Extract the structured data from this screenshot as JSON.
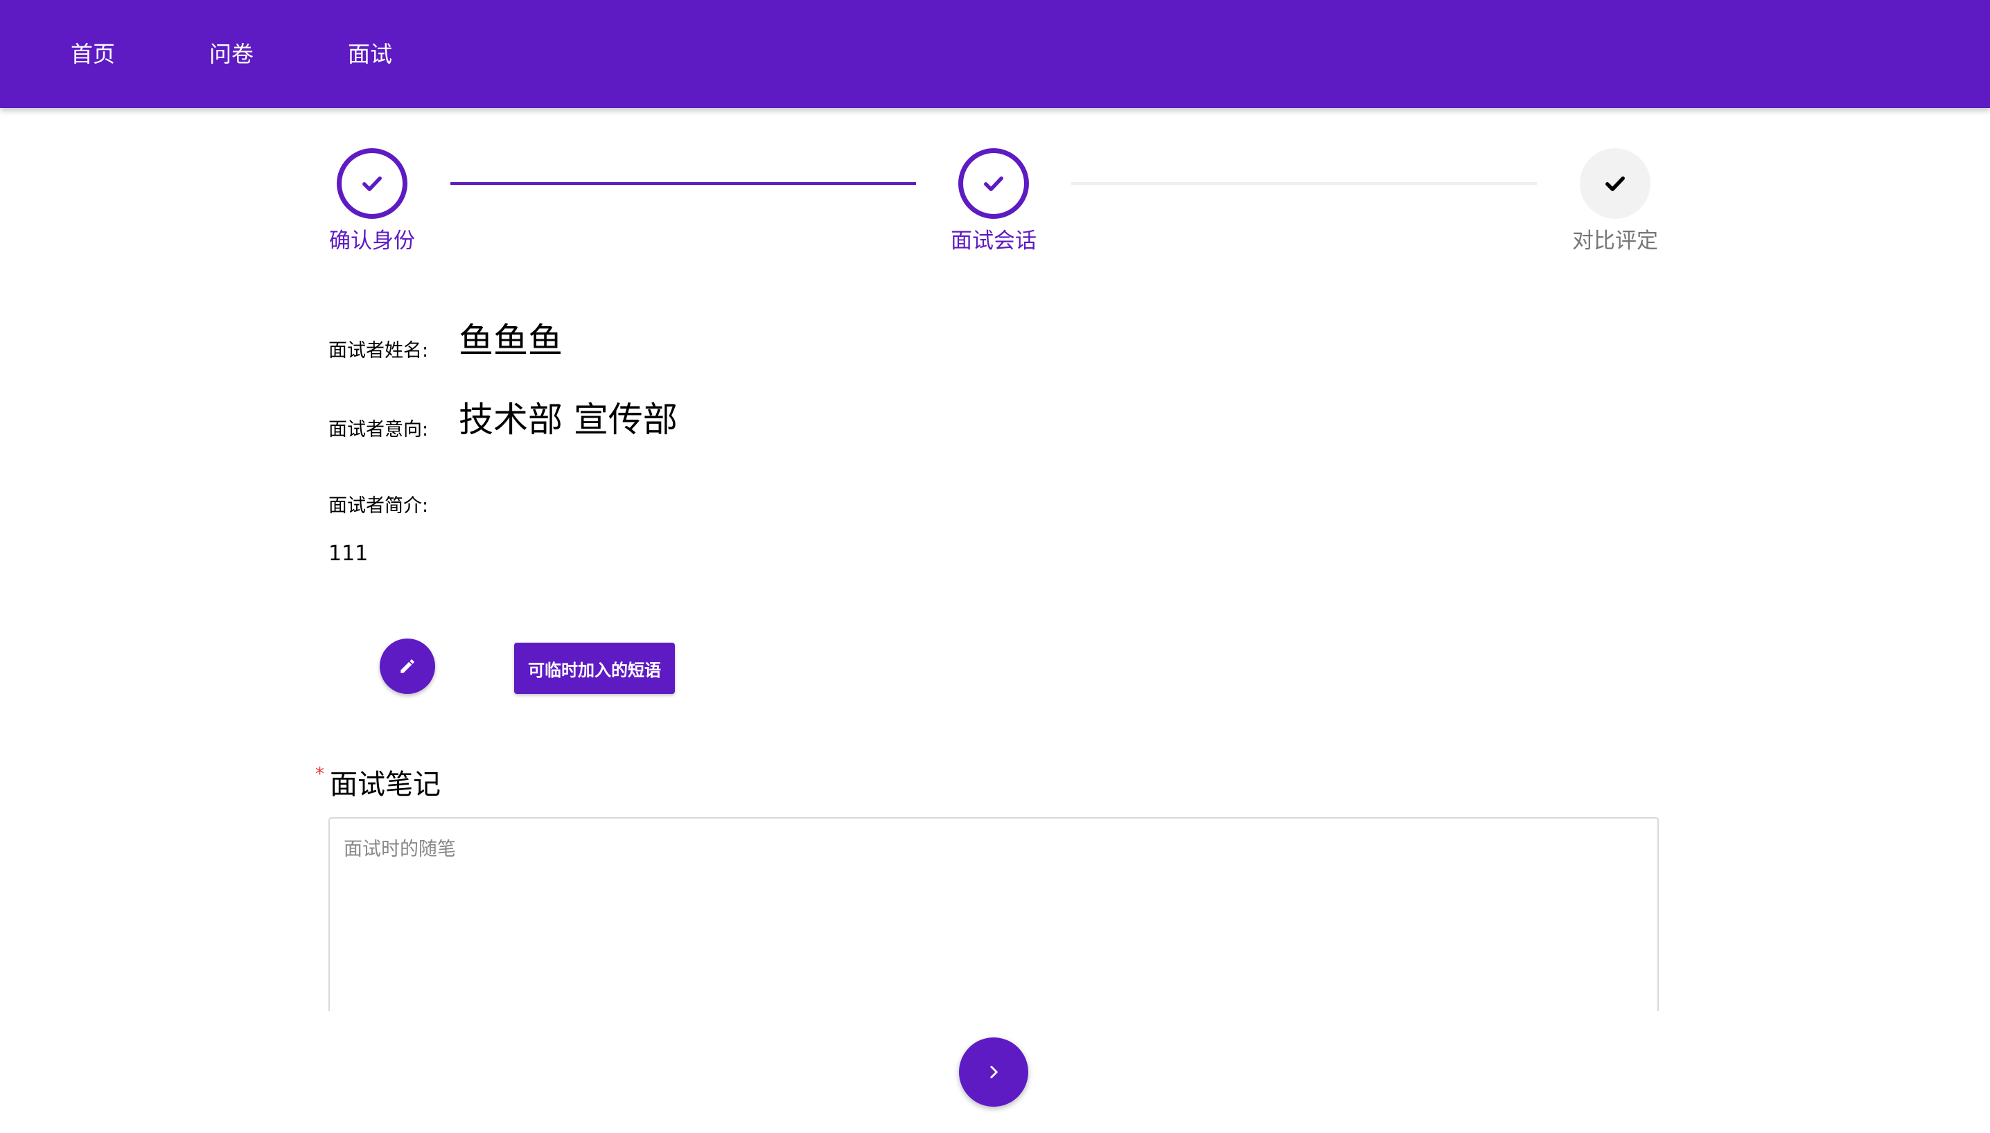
{
  "nav": {
    "items": [
      {
        "label": "首页"
      },
      {
        "label": "问卷"
      },
      {
        "label": "面试"
      }
    ]
  },
  "stepper": {
    "steps": [
      {
        "label": "确认身份",
        "state": "done",
        "icon": "check-icon"
      },
      {
        "label": "面试会话",
        "state": "done",
        "icon": "check-icon"
      },
      {
        "label": "对比评定",
        "state": "todo",
        "icon": "check-icon"
      }
    ]
  },
  "candidate": {
    "name_label": "面试者姓名:",
    "name_value": "鱼鱼鱼",
    "intent_label": "面试者意向:",
    "intent_value": "技术部 宣传部",
    "intro_label": "面试者简介:",
    "intro_value": "111"
  },
  "actions": {
    "edit_icon": "pencil-icon",
    "phrase_button_label": "可临时加入的短语"
  },
  "notes": {
    "required_mark": "*",
    "label": "面试笔记",
    "value": "",
    "placeholder": "面试时的随笔"
  },
  "footer": {
    "next_icon": "chevron-right-icon"
  },
  "colors": {
    "primary": "#5e1bc4",
    "required": "#e53935",
    "inactive_step": "#f2f2f2"
  }
}
